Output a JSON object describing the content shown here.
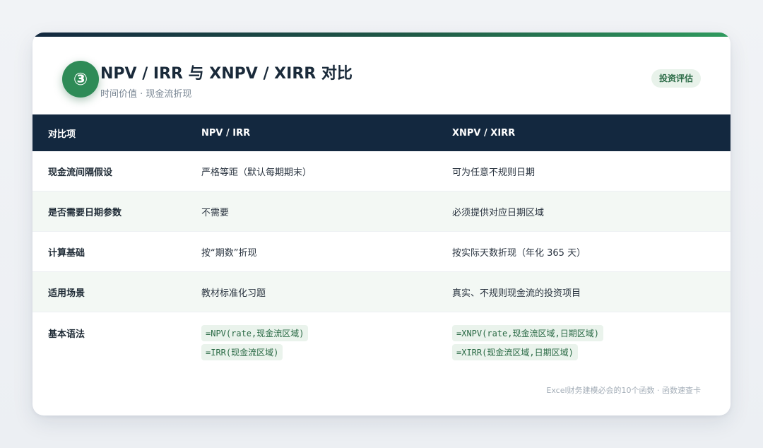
{
  "section": {
    "number": "③",
    "title": "NPV / IRR 与 XNPV / XIRR 对比",
    "subtitle": "时间价值 · 现金流折现",
    "tag": "投资评估"
  },
  "table": {
    "headers": [
      "对比项",
      "NPV / IRR",
      "XNPV / XIRR"
    ],
    "rows": [
      {
        "item": "现金流间隔假设",
        "npv": "严格等距（默认每期期末）",
        "xnpv": "可为任意不规则日期"
      },
      {
        "item": "是否需要日期参数",
        "npv": "不需要",
        "xnpv": "必须提供对应日期区域"
      },
      {
        "item": "计算基础",
        "npv": "按“期数”折现",
        "xnpv": "按实际天数折现（年化 365 天）"
      },
      {
        "item": "适用场景",
        "npv": "教材标准化习题",
        "xnpv": "真实、不规则现金流的投资项目"
      }
    ],
    "syntax": {
      "item": "基本语法",
      "npv": [
        "=NPV(rate,现金流区域)",
        "=IRR(现金流区域)"
      ],
      "xnpv": [
        "=XNPV(rate,现金流区域,日期区域)",
        "=XIRR(现金流区域,日期区域)"
      ]
    }
  },
  "footer": "Excel财务建模必会的10个函数 · 函数速查卡",
  "colors": {
    "accent": "#2e8b57",
    "header_bg": "#13283f",
    "alt_row": "#f3f8f4"
  }
}
